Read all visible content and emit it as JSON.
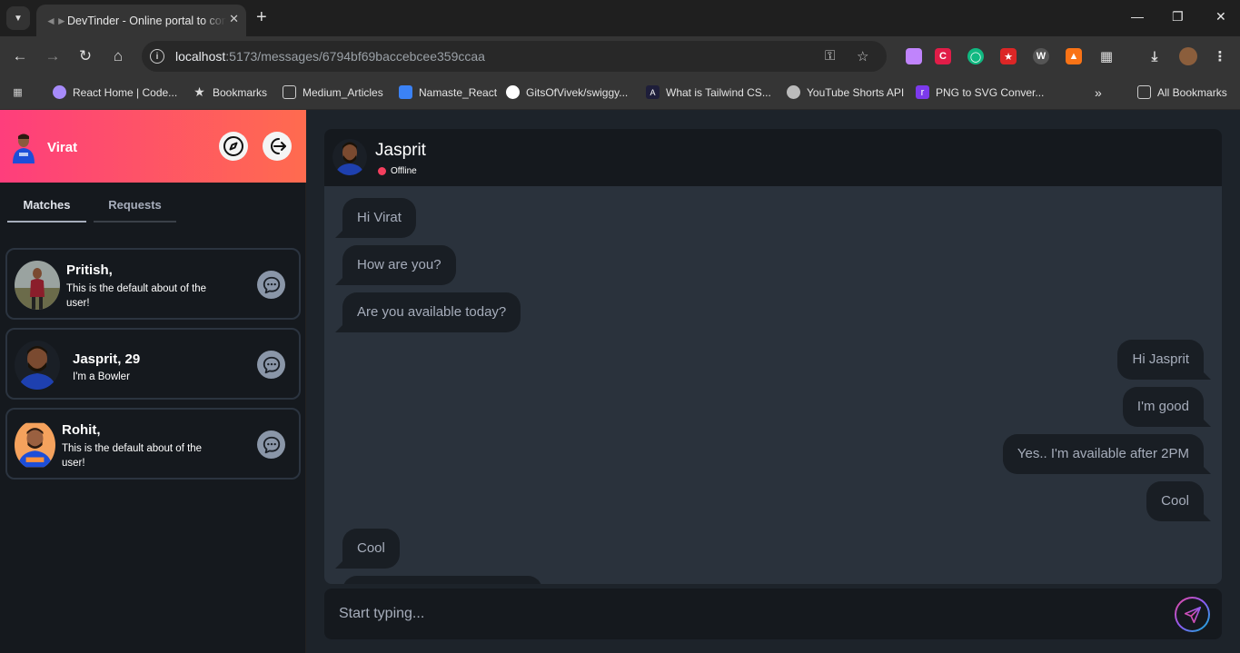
{
  "browser": {
    "tab_title": "DevTinder - Online portal to connect developers",
    "url_host": "localhost",
    "url_rest": ":5173/messages/6794bf69baccebcee359ccaa",
    "bookmarks": [
      {
        "label": "React Home | Code..."
      },
      {
        "label": "Bookmarks"
      },
      {
        "label": "Medium_Articles"
      },
      {
        "label": "Namaste_React"
      },
      {
        "label": "GitsOfVivek/swiggy..."
      },
      {
        "label": "What is Tailwind CS..."
      },
      {
        "label": "YouTube Shorts API"
      },
      {
        "label": "PNG to SVG Conver..."
      }
    ],
    "all_bookmarks": "All Bookmarks",
    "more": "»"
  },
  "sidebar": {
    "user_name": "Virat",
    "tabs": [
      {
        "label": "Matches",
        "active": true
      },
      {
        "label": "Requests",
        "active": false
      }
    ],
    "matches": [
      {
        "name": "Pritish,",
        "about": "This is the default about of the user!"
      },
      {
        "name": "Jasprit, 29",
        "about": "I'm a Bowler"
      },
      {
        "name": "Rohit,",
        "about": "This is the default about of the user!"
      }
    ]
  },
  "chat": {
    "contact_name": "Jasprit",
    "status": "Offline",
    "messages": [
      {
        "text": "Hi Virat",
        "from": "in"
      },
      {
        "text": "How are you?",
        "from": "in"
      },
      {
        "text": "Are you available today?",
        "from": "in"
      },
      {
        "text": "Hi Jasprit",
        "from": "out"
      },
      {
        "text": "I'm good",
        "from": "out"
      },
      {
        "text": "Yes.. I'm available after 2PM",
        "from": "out"
      },
      {
        "text": "Cool",
        "from": "out"
      },
      {
        "text": "Cool",
        "from": "in"
      }
    ],
    "input_placeholder": "Start typing..."
  },
  "colors": {
    "header_gradient_start": "#fe3e7c",
    "header_gradient_end": "#ff6b4f",
    "offline_dot": "#f43f5e",
    "bubble_bg": "#191e24"
  }
}
